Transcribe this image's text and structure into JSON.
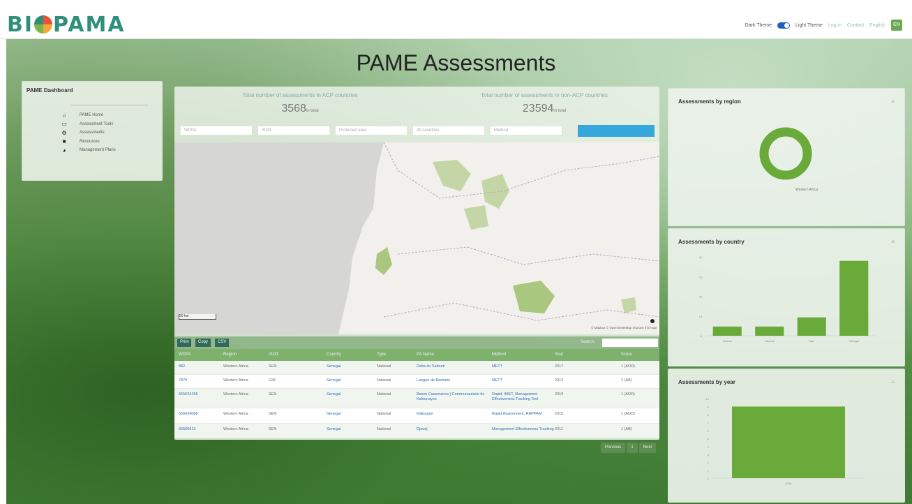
{
  "header": {
    "logo": "BIOPAMA",
    "logo_left": "BI",
    "logo_right": "PAMA",
    "toggle_left_label": "Dark Theme",
    "toggle_right_label": "Light Theme",
    "nav_links": [
      "Log in",
      "Contact",
      "English"
    ],
    "lang_badge": "EN"
  },
  "page": {
    "title": "PAME Assessments"
  },
  "dashboard": {
    "title": "PAME Dashboard",
    "items": [
      {
        "icon": "home-icon",
        "glyph": "⌂",
        "label": "PAME Home"
      },
      {
        "icon": "chart-icon",
        "glyph": "▭",
        "label": "Assessment Tools"
      },
      {
        "icon": "gear-icon",
        "glyph": "⚙",
        "label": "Assessments"
      },
      {
        "icon": "book-icon",
        "glyph": "■",
        "label": "Resources"
      },
      {
        "icon": "globe-icon",
        "glyph": "◕",
        "label": "Management Plans"
      }
    ]
  },
  "stats": {
    "acp_label": "Total number of assessments in ACP countries",
    "acp_value": "3568",
    "acp_unit": "in total",
    "nonacp_label": "Total number of assessments in non-ACP countries",
    "nonacp_value": "23594",
    "nonacp_unit": "in total"
  },
  "filters": {
    "placeholders": [
      "WDPA",
      "ISO3",
      "Protected area",
      "All countries",
      "Method"
    ],
    "button_label": ""
  },
  "map": {
    "scale_label": "50 km",
    "attribution": "© Mapbox © OpenStreetMap  Improve this map"
  },
  "table": {
    "toolbar_buttons": [
      "Print",
      "Copy",
      "CSV"
    ],
    "search_label": "Search:",
    "columns": [
      "WDPA",
      "Region",
      "ISO3",
      "Country",
      "Type",
      "PA Name",
      "Method",
      "Year",
      "Score"
    ],
    "rows": [
      [
        "882",
        "Western Africa",
        "SEN",
        "Senegal",
        "National",
        "Delta du Saloum",
        "METT",
        "2017",
        "1 (ADD)"
      ],
      [
        "7870",
        "Western Africa",
        "GIN",
        "Senegal",
        "National",
        "Langue de Barbarie",
        "METT",
        "2013",
        "2 (AB)"
      ],
      [
        "555624155",
        "Western Africa",
        "SEN",
        "Senegal",
        "National",
        "Basse Casamance | Communautaire du Kalounayes",
        "Rapid, IMET, Management Effectiveness Tracking Tool",
        "2019",
        "1 (ADD)"
      ],
      [
        "555624088",
        "Western Africa",
        "SEN",
        "Senegal",
        "National",
        "Kalissaye",
        "Rapid Assessment, RAPPAM",
        "2015",
        "1 (ADD)"
      ],
      [
        "55560913",
        "Western Africa",
        "SEN",
        "Senegal",
        "National",
        "Djoudj",
        "Management Effectiveness Tracking",
        "2011",
        "1 (AB)"
      ]
    ],
    "pager": [
      "Previous",
      "1",
      "Next"
    ]
  },
  "colors": {
    "accent_green": "#6aaa3a",
    "filter_button": "#35a7dd",
    "link": "#2a6fb3"
  },
  "charts_meta": {
    "region_title": "Assessments by region",
    "country_title": "Assessments by country",
    "year_title": "Assessments by year"
  },
  "chart_data": [
    {
      "type": "pie",
      "title": "Assessments by region",
      "categories": [
        "Western Africa"
      ],
      "values": [
        100
      ]
    },
    {
      "type": "bar",
      "title": "Assessments by country",
      "categories": [
        "Guinea",
        "Gambia",
        "Mali",
        "Senegal"
      ],
      "values": [
        7,
        7,
        14,
        57
      ],
      "ylim": [
        0,
        60
      ]
    },
    {
      "type": "bar",
      "title": "Assessments by year",
      "categories": [
        "2016"
      ],
      "values": [
        9
      ],
      "ylim": [
        0,
        10
      ],
      "yticks": [
        0,
        1,
        2,
        3,
        4,
        5,
        6,
        7,
        8,
        9,
        10
      ]
    }
  ]
}
